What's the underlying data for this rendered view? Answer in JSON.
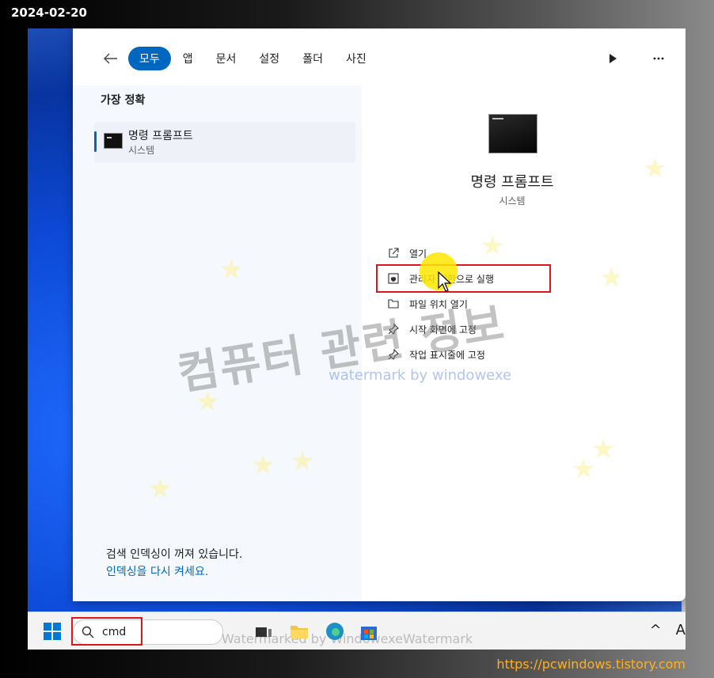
{
  "overlay": {
    "date": "2024-02-20",
    "site_url": "https://pcwindows.tistory.com"
  },
  "search_panel": {
    "tabs": [
      {
        "label": "모두",
        "active": true
      },
      {
        "label": "앱"
      },
      {
        "label": "문서"
      },
      {
        "label": "설정"
      },
      {
        "label": "폴더"
      },
      {
        "label": "사진"
      }
    ],
    "section_title": "가장 정확",
    "best_match": {
      "name": "명령 프롬프트",
      "type": "시스템"
    },
    "detail": {
      "name": "명령 프롬프트",
      "type": "시스템",
      "actions": [
        {
          "label": "열기",
          "icon": "open-external-icon"
        },
        {
          "label": "관리자 권한으로 실행",
          "icon": "shield-icon",
          "highlighted": true
        },
        {
          "label": "파일 위치 열기",
          "icon": "folder-icon"
        },
        {
          "label": "시작 화면에 고정",
          "icon": "pin-icon"
        },
        {
          "label": "작업 표시줄에 고정",
          "icon": "pin-icon"
        }
      ]
    },
    "index_notice": "검색 인덱싱이 꺼져 있습니다.",
    "index_link": "인덱싱을 다시 켜세요."
  },
  "watermarks": {
    "main": "컴퓨터 관련 정보",
    "sub": "watermark by windowexe",
    "taskbar": "Watermarked by WindowexeWatermark"
  },
  "taskbar": {
    "search_value": "cmd",
    "tray_chevron": "^",
    "tray_ime": "A"
  },
  "colors": {
    "accent": "#0067c0",
    "highlight_box": "#e0141e",
    "site_link": "#ffb020"
  }
}
